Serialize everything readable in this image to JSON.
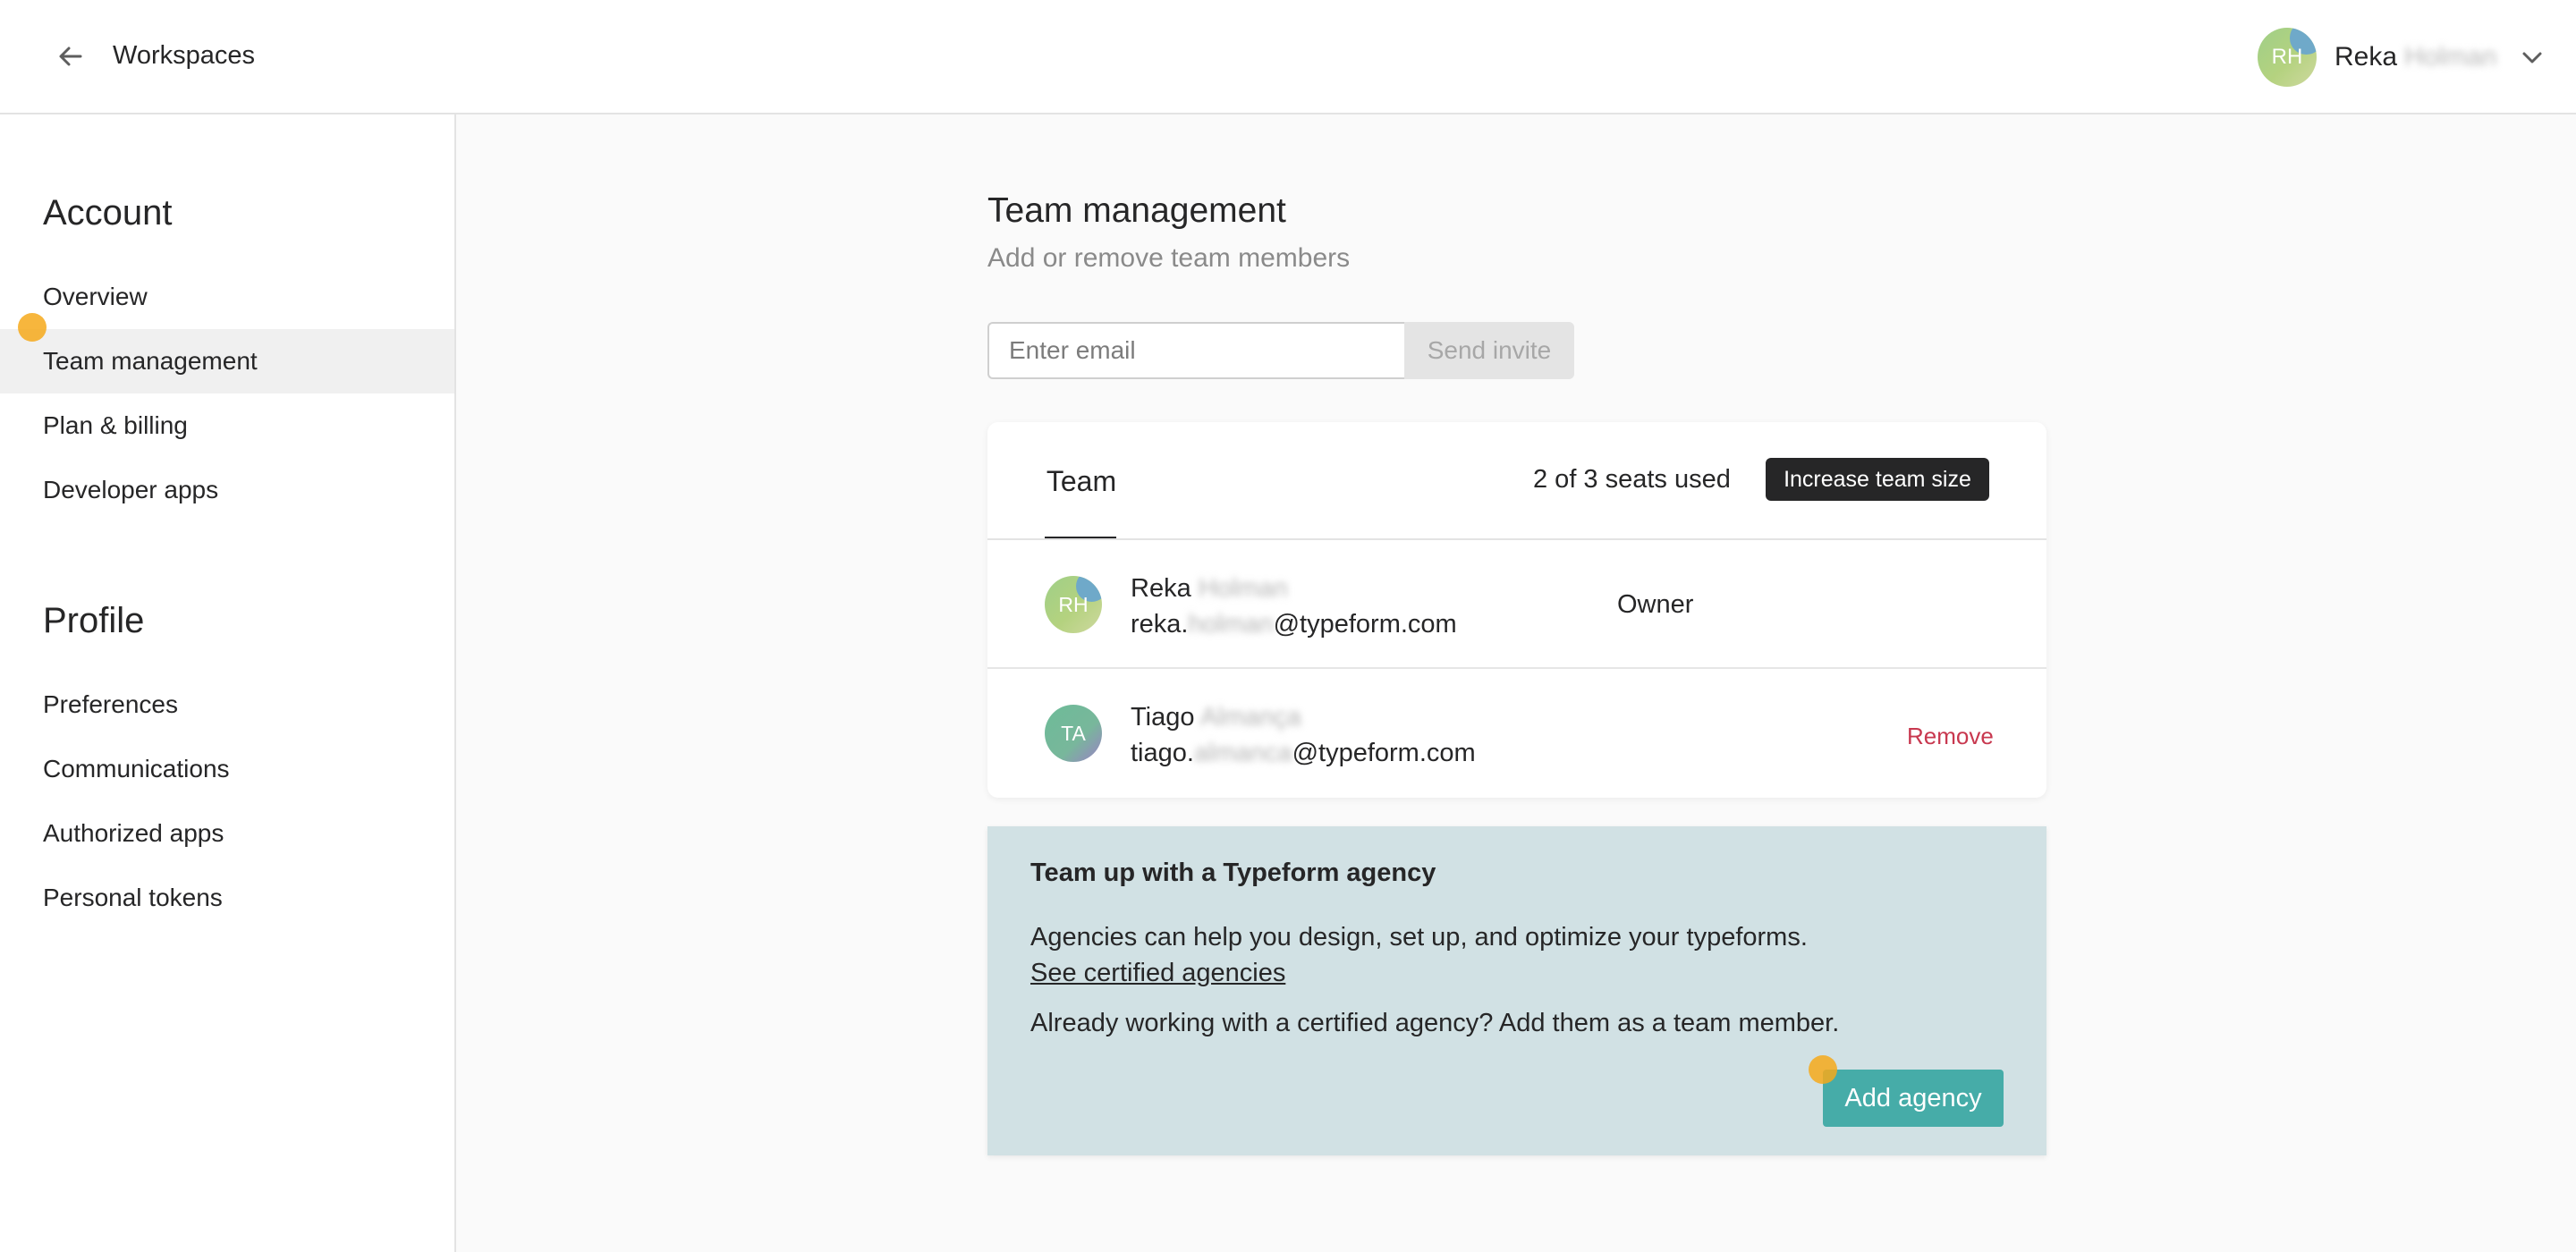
{
  "colors": {
    "primary_button": "#46aca8",
    "dark_button": "#262627",
    "remove_text": "#c8384f",
    "agency_background": "#d1e1e4",
    "cursor_indicator": "#f6a91b"
  },
  "header": {
    "back_label": "Workspaces",
    "back_icon": "arrow-left-icon",
    "user": {
      "initials": "RH",
      "first_name": "Reka",
      "last_name": "Holman",
      "dropdown_icon": "chevron-down-icon"
    }
  },
  "sidebar": {
    "account_heading": "Account",
    "account_items": [
      {
        "label": "Overview",
        "active": false
      },
      {
        "label": "Team management",
        "active": true
      },
      {
        "label": "Plan & billing",
        "active": false
      },
      {
        "label": "Developer apps",
        "active": false
      }
    ],
    "profile_heading": "Profile",
    "profile_items": [
      {
        "label": "Preferences"
      },
      {
        "label": "Communications"
      },
      {
        "label": "Authorized apps"
      },
      {
        "label": "Personal tokens"
      }
    ]
  },
  "main": {
    "title": "Team management",
    "subtitle": "Add or remove team members",
    "invite": {
      "email_value": "",
      "email_placeholder": "Enter email",
      "send_label": "Send invite"
    },
    "team": {
      "tab_label": "Team",
      "seats_text": "2 of 3 seats used",
      "increase_label": "Increase team size",
      "members": [
        {
          "initials": "RH",
          "first_name": "Reka",
          "last_name": "Holman",
          "email_prefix": "reka.",
          "email_hidden": "holman",
          "email_domain": "@typeform.com",
          "role": "Owner",
          "action": ""
        },
        {
          "initials": "TA",
          "first_name": "Tiago",
          "last_name": "Almança",
          "email_prefix": "tiago.",
          "email_hidden": "almanca",
          "email_domain": "@typeform.com",
          "role": "",
          "action": "Remove"
        }
      ]
    },
    "agency": {
      "title": "Team up with a Typeform agency",
      "description": "Agencies can help you design, set up, and optimize your typeforms.",
      "link_label": "See certified agencies",
      "already_text": "Already working with a certified agency? Add them as a team member.",
      "button_label": "Add agency"
    }
  }
}
